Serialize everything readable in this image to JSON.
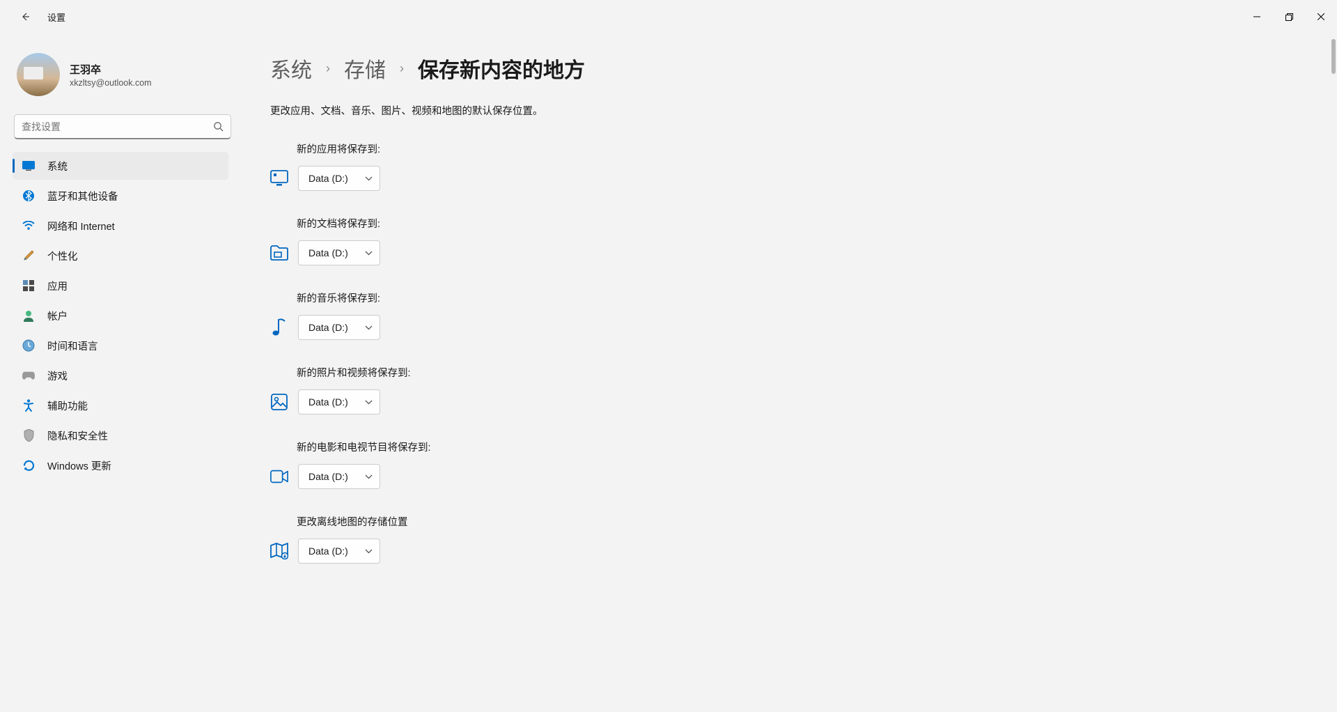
{
  "window": {
    "title": "设置"
  },
  "profile": {
    "name": "王羽卒",
    "email": "xkzltsy@outlook.com"
  },
  "search": {
    "placeholder": "查找设置"
  },
  "sidebar": {
    "items": [
      {
        "icon": "system",
        "label": "系统",
        "active": true
      },
      {
        "icon": "bluetooth",
        "label": "蓝牙和其他设备"
      },
      {
        "icon": "wifi",
        "label": "网络和 Internet"
      },
      {
        "icon": "personalize",
        "label": "个性化"
      },
      {
        "icon": "apps",
        "label": "应用"
      },
      {
        "icon": "account",
        "label": "帐户"
      },
      {
        "icon": "time",
        "label": "时间和语言"
      },
      {
        "icon": "gaming",
        "label": "游戏"
      },
      {
        "icon": "accessibility",
        "label": "辅助功能"
      },
      {
        "icon": "privacy",
        "label": "隐私和安全性"
      },
      {
        "icon": "update",
        "label": "Windows 更新"
      }
    ]
  },
  "breadcrumb": {
    "level1": "系统",
    "level2": "存储",
    "current": "保存新内容的地方"
  },
  "description": "更改应用、文档、音乐、图片、视频和地图的默认保存位置。",
  "settings": [
    {
      "label": "新的应用将保存到:",
      "value": "Data (D:)",
      "icon": "monitor"
    },
    {
      "label": "新的文档将保存到:",
      "value": "Data (D:)",
      "icon": "folder"
    },
    {
      "label": "新的音乐将保存到:",
      "value": "Data (D:)",
      "icon": "music"
    },
    {
      "label": "新的照片和视频将保存到:",
      "value": "Data (D:)",
      "icon": "image"
    },
    {
      "label": "新的电影和电视节目将保存到:",
      "value": "Data (D:)",
      "icon": "video"
    },
    {
      "label": "更改离线地图的存储位置",
      "value": "Data (D:)",
      "icon": "map"
    }
  ]
}
